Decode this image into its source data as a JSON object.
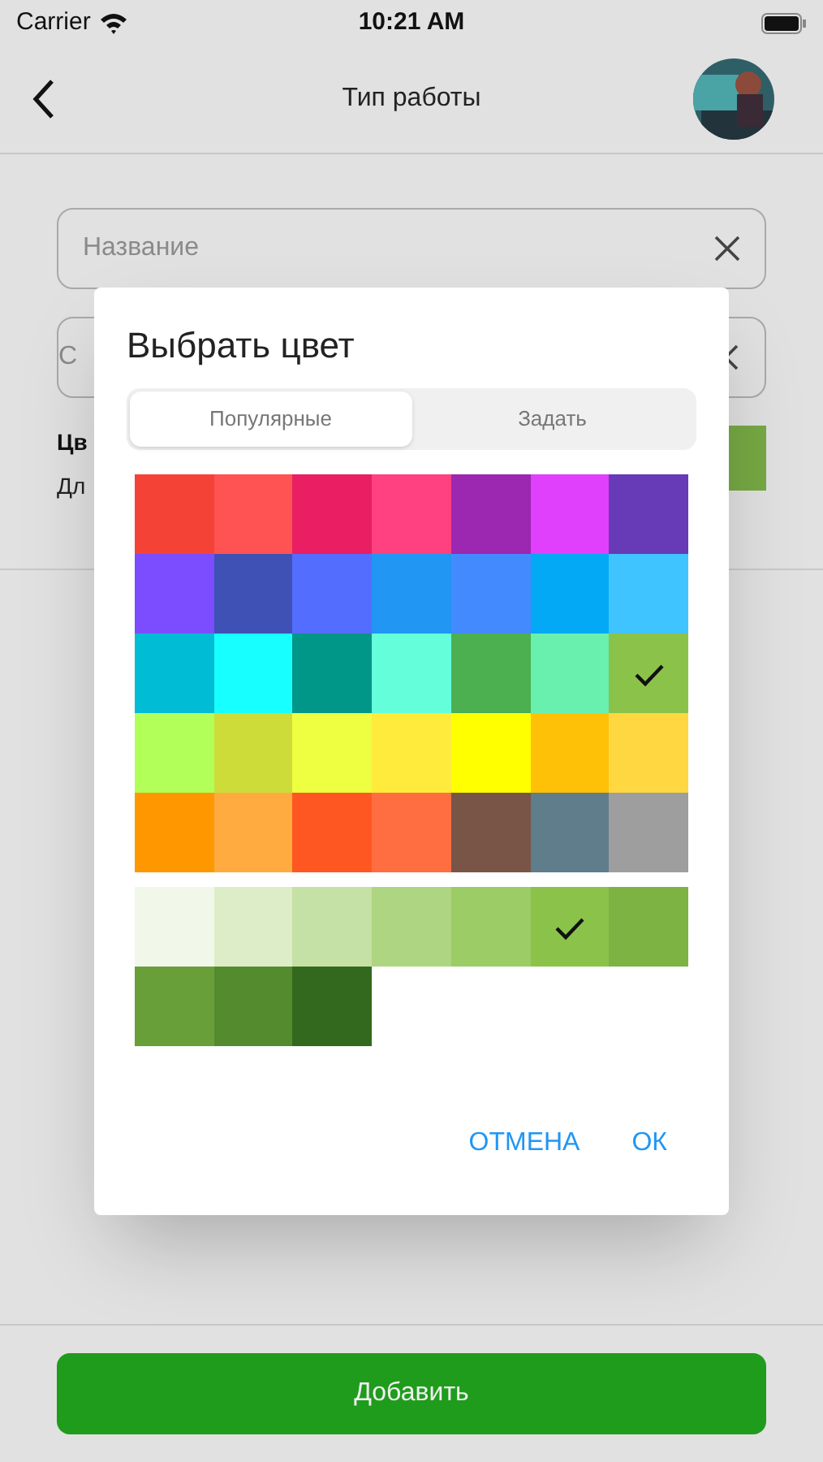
{
  "status_bar": {
    "carrier": "Carrier",
    "time": "10:21 AM"
  },
  "header": {
    "title": "Тип работы"
  },
  "form": {
    "name_field": {
      "placeholder": "Название"
    },
    "second_field": {
      "value": "С"
    },
    "color_label": "Цв",
    "color_hint": "Дл",
    "color_swatch": {
      "color": "#76a944"
    }
  },
  "dialog": {
    "title": "Выбрать цвет",
    "tabs": [
      {
        "label": "Популярные",
        "selected": true
      },
      {
        "label": "Задать",
        "selected": false
      }
    ],
    "palette": [
      {
        "color": "#f44336",
        "selected": false
      },
      {
        "color": "#ff5252",
        "selected": false
      },
      {
        "color": "#e91e63",
        "selected": false
      },
      {
        "color": "#ff4081",
        "selected": false
      },
      {
        "color": "#9c27b0",
        "selected": false
      },
      {
        "color": "#e040fb",
        "selected": false
      },
      {
        "color": "#673ab7",
        "selected": false
      },
      {
        "color": "#7c4dff",
        "selected": false
      },
      {
        "color": "#3f51b5",
        "selected": false
      },
      {
        "color": "#536dfe",
        "selected": false
      },
      {
        "color": "#2196f3",
        "selected": false
      },
      {
        "color": "#448aff",
        "selected": false
      },
      {
        "color": "#03a9f4",
        "selected": false
      },
      {
        "color": "#40c4ff",
        "selected": false
      },
      {
        "color": "#00bcd4",
        "selected": false
      },
      {
        "color": "#18ffff",
        "selected": false
      },
      {
        "color": "#009688",
        "selected": false
      },
      {
        "color": "#64ffda",
        "selected": false
      },
      {
        "color": "#4caf50",
        "selected": false
      },
      {
        "color": "#69f0ae",
        "selected": false
      },
      {
        "color": "#8bc34a",
        "selected": true
      },
      {
        "color": "#b2ff59",
        "selected": false
      },
      {
        "color": "#cddc39",
        "selected": false
      },
      {
        "color": "#eeff41",
        "selected": false
      },
      {
        "color": "#ffeb3b",
        "selected": false
      },
      {
        "color": "#ffff00",
        "selected": false
      },
      {
        "color": "#ffc107",
        "selected": false
      },
      {
        "color": "#ffd740",
        "selected": false
      },
      {
        "color": "#ff9800",
        "selected": false
      },
      {
        "color": "#ffab40",
        "selected": false
      },
      {
        "color": "#ff5722",
        "selected": false
      },
      {
        "color": "#ff6e40",
        "selected": false
      },
      {
        "color": "#795548",
        "selected": false
      },
      {
        "color": "#607d8b",
        "selected": false
      },
      {
        "color": "#9e9e9e",
        "selected": false
      }
    ],
    "shades": [
      {
        "color": "#f1f8e9",
        "selected": false
      },
      {
        "color": "#dcedc8",
        "selected": false
      },
      {
        "color": "#c5e1a5",
        "selected": false
      },
      {
        "color": "#aed581",
        "selected": false
      },
      {
        "color": "#9ccc65",
        "selected": false
      },
      {
        "color": "#8bc34a",
        "selected": true
      },
      {
        "color": "#7cb342",
        "selected": false
      },
      {
        "color": "#689f38",
        "selected": false
      },
      {
        "color": "#558b2f",
        "selected": false
      },
      {
        "color": "#33691e",
        "selected": false
      }
    ],
    "buttons": [
      "ОТМЕНА",
      "ОК"
    ]
  },
  "add_button": "Добавить"
}
